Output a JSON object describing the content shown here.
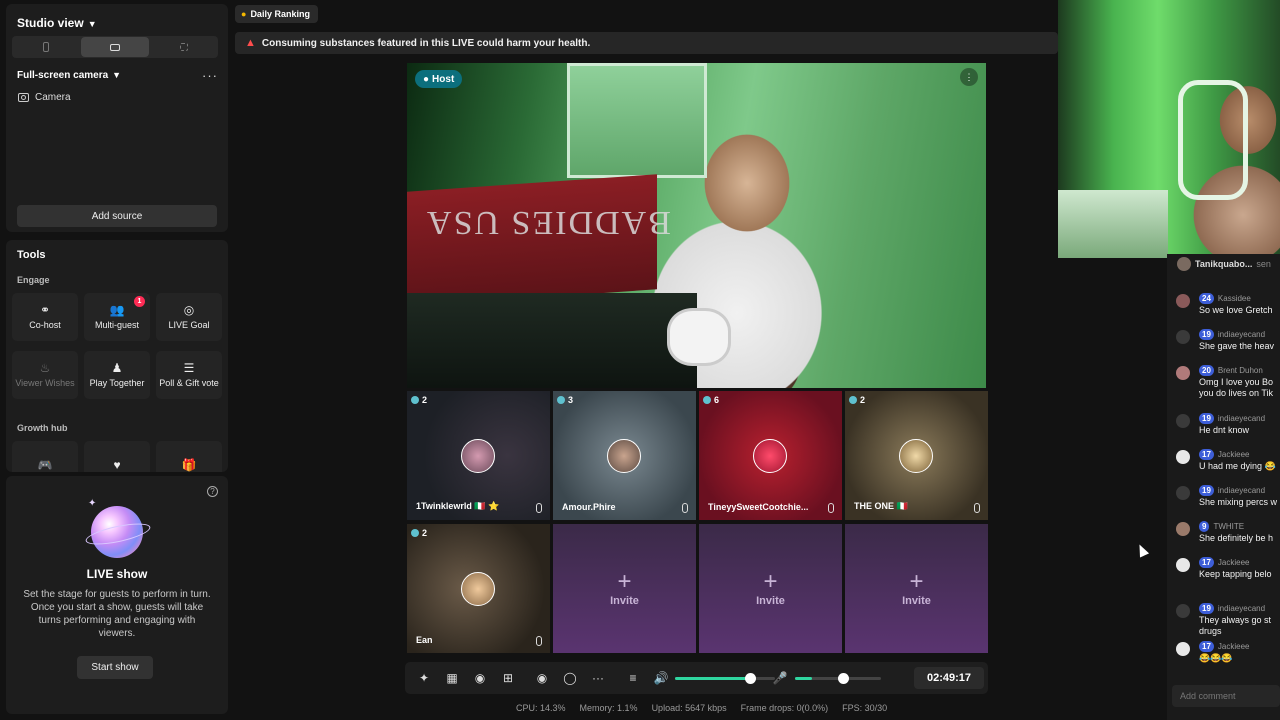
{
  "sidebar": {
    "studio_title": "Studio view",
    "scene_title": "Full-screen camera",
    "sources": [
      {
        "label": "Camera",
        "icon": "camera-icon"
      }
    ],
    "add_source_label": "Add source",
    "tools_title": "Tools",
    "engage_label": "Engage",
    "engage_tools": [
      {
        "label": "Co-host",
        "icon": "link-icon",
        "enabled": true
      },
      {
        "label": "Multi-guest",
        "icon": "users-icon",
        "badge": "1",
        "enabled": true
      },
      {
        "label": "LIVE Goal",
        "icon": "goal-icon",
        "enabled": true
      },
      {
        "label": "Viewer Wishes",
        "icon": "wish-icon",
        "enabled": false
      },
      {
        "label": "Play Together",
        "icon": "play-icon",
        "enabled": true
      },
      {
        "label": "Poll & Gift vote",
        "icon": "poll-icon",
        "enabled": true
      }
    ],
    "growth_label": "Growth hub",
    "live_show": {
      "title": "LIVE show",
      "description": "Set the stage for guests to perform in turn. Once you start a show, guests will take turns performing and engaging with viewers.",
      "start_label": "Start show"
    }
  },
  "topbar": {
    "ranking_label": "Daily Ranking",
    "warning": "Consuming substances featured in this LIVE could harm your health."
  },
  "stage": {
    "host_tag": "Host",
    "host_banner_text": "BADDIES USA",
    "guests": [
      {
        "name": "1Twinklewrld 🇮🇹 ⭐",
        "count": "2"
      },
      {
        "name": "Amour.Phire",
        "count": "3"
      },
      {
        "name": "TineyySweetCootchie...",
        "count": "6"
      },
      {
        "name": "THE ONE 🇮🇹",
        "count": "2"
      },
      {
        "name": "Ean",
        "count": "2"
      }
    ],
    "invite_label": "Invite"
  },
  "controls": {
    "timer": "02:49:17",
    "volume_level": 0.75,
    "mic_level": 0.2,
    "stats": {
      "cpu": "CPU: 14.3%",
      "memory": "Memory: 1.1%",
      "upload": "Upload: 5647 kbps",
      "frame_drops": "Frame drops: 0(0.0%)",
      "fps": "FPS: 30/30"
    }
  },
  "chat": {
    "header_user": "Tanikquabo...",
    "header_suffix": "sen",
    "messages": [
      {
        "level": "24",
        "user": "Kassidee",
        "text": "So we love Gretch"
      },
      {
        "level": "19",
        "user": "indiaeyecand",
        "text": "She gave the heav"
      },
      {
        "level": "20",
        "user": "Brent Duhon",
        "text": "Omg I love you Bo you do lives on Tik"
      },
      {
        "level": "19",
        "user": "indiaeyecand",
        "text": "He dnt know"
      },
      {
        "level": "17",
        "user": "Jackieee",
        "text": "U had me dying 😂"
      },
      {
        "level": "19",
        "user": "indiaeyecand",
        "text": "She mixing percs w"
      },
      {
        "level": "9",
        "user": "TWHITE",
        "text": "She definitely be h"
      },
      {
        "level": "17",
        "user": "Jackieee",
        "text": "Keep tapping belo"
      },
      {
        "level": "19",
        "user": "indiaeyecand",
        "text": "They always go st drugs"
      },
      {
        "level": "17",
        "user": "Jackieee",
        "text": "😂😂😂"
      }
    ],
    "add_comment_placeholder": "Add comment"
  },
  "colors": {
    "background": "#121212",
    "panel": "#1d1d1d",
    "host_tag": "#0c6f7d",
    "badge_red": "#fe2c55",
    "level_badge": "#3d5ed8",
    "slider_fill": "#2fd6a0",
    "invite_tile": "#5a3470"
  }
}
